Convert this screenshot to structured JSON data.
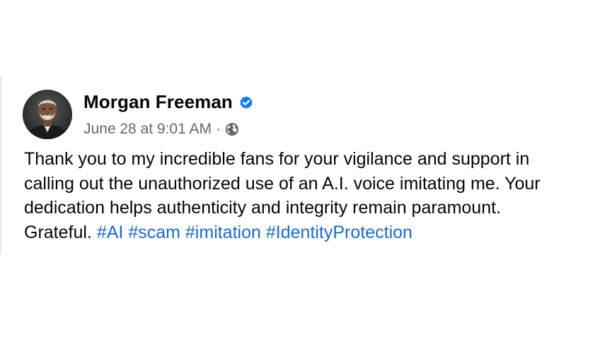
{
  "post": {
    "author": {
      "name": "Morgan Freeman",
      "verified_icon": "verified-badge-icon",
      "avatar_icon": "profile-photo"
    },
    "meta": {
      "timestamp": "June 28 at 9:01 AM",
      "separator": "·",
      "audience_icon": "globe-icon"
    },
    "body_lines": [
      "Thank you to my incredible fans for your vigilance and support in",
      "calling out the unauthorized use of an A.I. voice imitating me. Your",
      "dedication helps authenticity and integrity remain paramount."
    ],
    "last_line_text": "Grateful.",
    "hashtags": [
      "#AI",
      "#scam",
      "#imitation",
      "#IdentityProtection"
    ]
  },
  "colors": {
    "text": "#050505",
    "meta": "#65676b",
    "hashtag": "#1b6bc7",
    "verified": "#1877f2",
    "card_border": "#e6e6e6"
  }
}
